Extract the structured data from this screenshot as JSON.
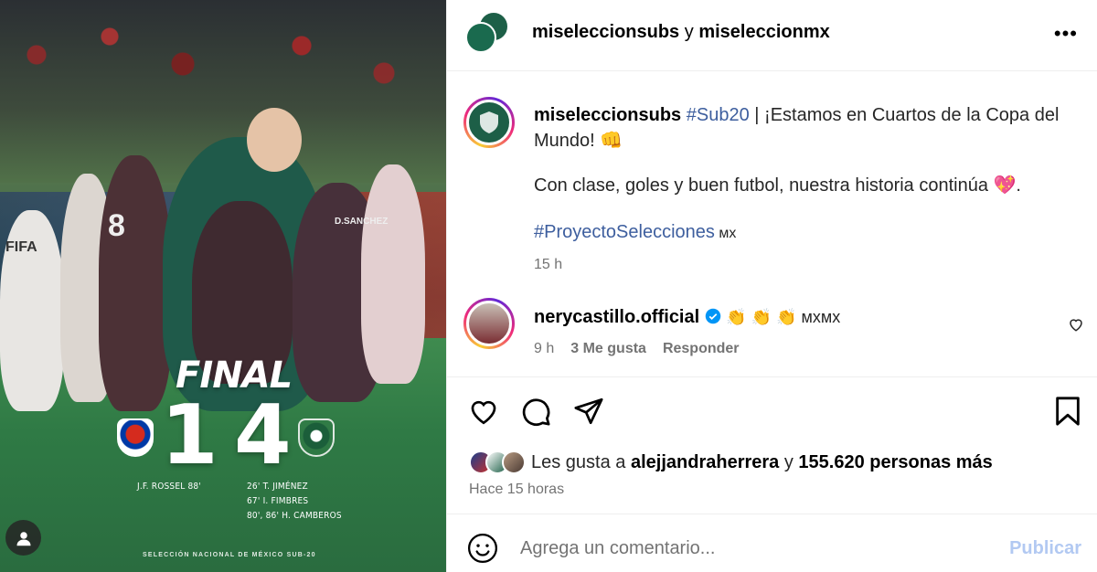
{
  "image": {
    "final_label": "FINAL",
    "home_score": "1",
    "away_score": "4",
    "home_scorers": [
      "J.F. ROSSEL 88'"
    ],
    "away_scorers": [
      "26' T. JIMÉNEZ",
      "67' I. FIMBRES",
      "80', 86' H. CAMBEROS"
    ],
    "footer": "SELECCIÓN NACIONAL DE MÉXICO SUB-20",
    "jersey_text": [
      "FIFA",
      "D.SANCHEZ",
      "8"
    ]
  },
  "header": {
    "user1": "miseleccionsubs",
    "connector": " y ",
    "user2": "miseleccionmx",
    "more": "•••"
  },
  "caption": {
    "user": "miseleccionsubs",
    "hashtag": "#Sub20",
    "line1": " | ¡Estamos en Cuartos de la Copa del",
    "line2": "Mundo! 👊",
    "line3": "Con clase, goles y buen futbol, nuestra historia continúa 💖.",
    "hashtag2": "#ProyectoSelecciones",
    "suffix": " ᴍx",
    "time": "15 h"
  },
  "comment1": {
    "user": "nerycastillo.official",
    "text": "👏 👏 👏 ᴍxᴍx",
    "time": "9 h",
    "likes": "3 Me gusta",
    "reply": "Responder"
  },
  "likes": {
    "prefix": "Les gusta a ",
    "user": "alejjandraherrera",
    "mid": " y ",
    "count": "155.620 personas más"
  },
  "post_time": "Hace 15 horas",
  "comment_box": {
    "placeholder": "Agrega un comentario...",
    "publish": "Publicar"
  },
  "colors": {
    "hashtag": "#3d5e9e",
    "publish_disabled": "#b2c9f2",
    "muted": "#737373",
    "verified": "#0095f6"
  }
}
